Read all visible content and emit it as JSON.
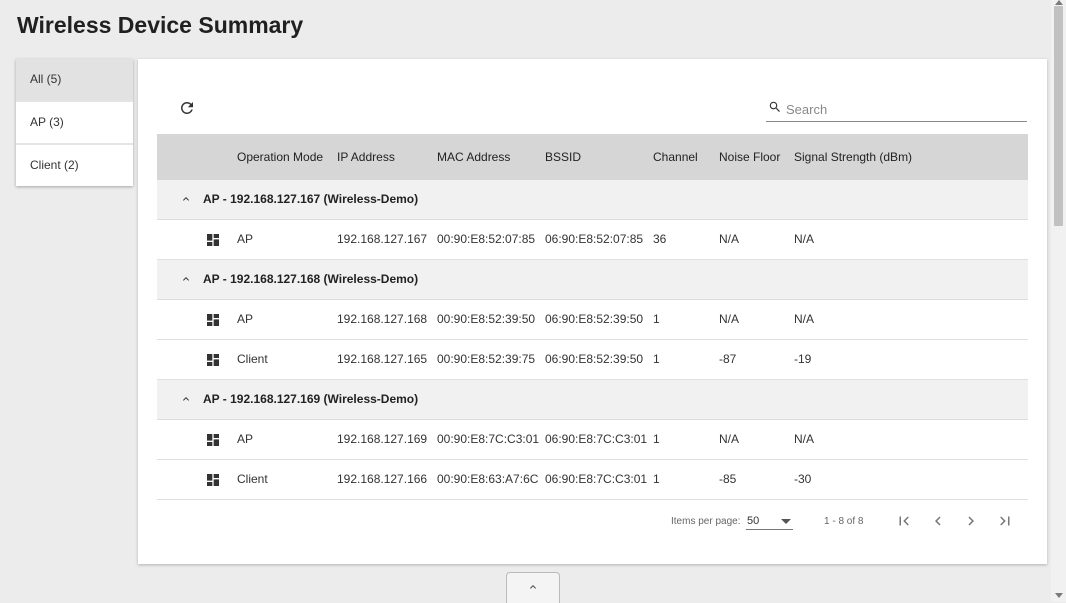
{
  "page_title": "Wireless Device Summary",
  "filter_tabs": [
    {
      "label": "All (5)",
      "active": true
    },
    {
      "label": "AP (3)",
      "active": false
    },
    {
      "label": "Client (2)",
      "active": false
    }
  ],
  "search": {
    "placeholder": "Search",
    "value": ""
  },
  "columns": [
    "Operation Mode",
    "IP Address",
    "MAC Address",
    "BSSID",
    "Channel",
    "Noise Floor",
    "Signal Strength (dBm)"
  ],
  "groups": [
    {
      "label": "AP - 192.168.127.167 (Wireless-Demo)",
      "rows": [
        {
          "mode": "AP",
          "ip": "192.168.127.167",
          "mac": "00:90:E8:52:07:85",
          "bssid": "06:90:E8:52:07:85",
          "channel": "36",
          "noise": "N/A",
          "signal": "N/A"
        }
      ]
    },
    {
      "label": "AP - 192.168.127.168 (Wireless-Demo)",
      "rows": [
        {
          "mode": "AP",
          "ip": "192.168.127.168",
          "mac": "00:90:E8:52:39:50",
          "bssid": "06:90:E8:52:39:50",
          "channel": "1",
          "noise": "N/A",
          "signal": "N/A"
        },
        {
          "mode": "Client",
          "ip": "192.168.127.165",
          "mac": "00:90:E8:52:39:75",
          "bssid": "06:90:E8:52:39:50",
          "channel": "1",
          "noise": "-87",
          "signal": "-19"
        }
      ]
    },
    {
      "label": "AP - 192.168.127.169 (Wireless-Demo)",
      "rows": [
        {
          "mode": "AP",
          "ip": "192.168.127.169",
          "mac": "00:90:E8:7C:C3:01",
          "bssid": "06:90:E8:7C:C3:01",
          "channel": "1",
          "noise": "N/A",
          "signal": "N/A"
        },
        {
          "mode": "Client",
          "ip": "192.168.127.166",
          "mac": "00:90:E8:63:A7:6C",
          "bssid": "06:90:E8:7C:C3:01",
          "channel": "1",
          "noise": "-85",
          "signal": "-30"
        }
      ]
    }
  ],
  "paginator": {
    "items_per_page_label": "Items per page:",
    "items_per_page": "50",
    "range": "1 - 8 of 8"
  },
  "icons": {
    "refresh": "refresh-icon",
    "search": "search-icon",
    "group_toggle": "chevron-up-icon",
    "device": "dashboard-icon",
    "first_page": "first-page-icon",
    "prev_page": "chevron-left-icon",
    "next_page": "chevron-right-icon",
    "last_page": "last-page-icon",
    "scroll_top": "chevron-up-icon"
  }
}
